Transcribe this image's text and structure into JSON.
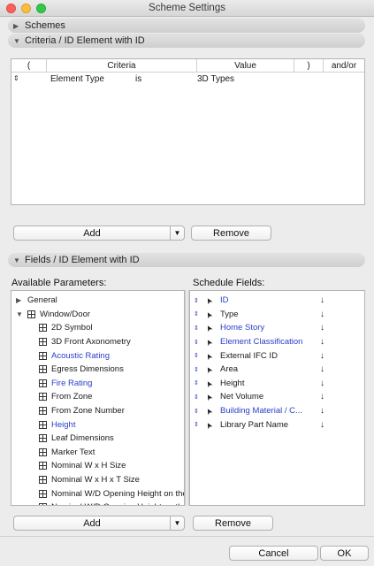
{
  "window": {
    "title": "Scheme Settings"
  },
  "schemes": {
    "label": "Schemes"
  },
  "criteria": {
    "label": "Criteria / ID Element with ID",
    "columns": [
      "(",
      "Criteria",
      "Value",
      ")",
      "and/or"
    ],
    "rows": [
      {
        "criteria": "Element Type",
        "op": "is",
        "value": "3D Types"
      }
    ],
    "add_label": "Add",
    "remove_label": "Remove"
  },
  "fields": {
    "label": "Fields / ID Element with ID",
    "available_label": "Available Parameters:",
    "schedule_label": "Schedule Fields:",
    "available": [
      {
        "text": "General",
        "level": 0,
        "expander": "collapsed",
        "icon": "none",
        "blue": false
      },
      {
        "text": "Window/Door",
        "level": 0,
        "expander": "expanded",
        "icon": "grid-icon",
        "blue": false
      },
      {
        "text": "2D Symbol",
        "level": 1,
        "icon": "grid-icon",
        "blue": false
      },
      {
        "text": "3D Front Axonometry",
        "level": 1,
        "icon": "grid-icon",
        "blue": false
      },
      {
        "text": "Acoustic Rating",
        "level": 1,
        "icon": "grid-icon",
        "blue": true
      },
      {
        "text": "Egress Dimensions",
        "level": 1,
        "icon": "grid-icon",
        "blue": false
      },
      {
        "text": "Fire Rating",
        "level": 1,
        "icon": "grid-icon",
        "blue": true
      },
      {
        "text": "From Zone",
        "level": 1,
        "icon": "grid-icon",
        "blue": false
      },
      {
        "text": "From Zone Number",
        "level": 1,
        "icon": "grid-icon",
        "blue": false
      },
      {
        "text": "Height",
        "level": 1,
        "icon": "grid-icon",
        "blue": true
      },
      {
        "text": "Leaf Dimensions",
        "level": 1,
        "icon": "grid-icon",
        "blue": false
      },
      {
        "text": "Marker Text",
        "level": 1,
        "icon": "grid-icon",
        "blue": false
      },
      {
        "text": "Nominal W x H Size",
        "level": 1,
        "icon": "grid-icon",
        "blue": false
      },
      {
        "text": "Nominal W x H x T Size",
        "level": 1,
        "icon": "grid-icon",
        "blue": false
      },
      {
        "text": "Nominal W/D Opening Height on the",
        "level": 1,
        "icon": "grid-icon",
        "blue": false
      },
      {
        "text": "Nominal W/D Opening Height on th",
        "level": 1,
        "icon": "grid-icon",
        "blue": false
      }
    ],
    "schedule": [
      {
        "text": "ID",
        "blue": true
      },
      {
        "text": "Type",
        "blue": false
      },
      {
        "text": "Home Story",
        "blue": true
      },
      {
        "text": "Element Classification",
        "blue": true
      },
      {
        "text": "External IFC ID",
        "blue": false
      },
      {
        "text": "Area",
        "blue": false
      },
      {
        "text": "Height",
        "blue": false
      },
      {
        "text": "Net Volume",
        "blue": false
      },
      {
        "text": "Building Material / C...",
        "blue": true
      },
      {
        "text": "Library Part Name",
        "blue": false
      }
    ],
    "add_label": "Add",
    "remove_label": "Remove"
  },
  "footer": {
    "cancel_label": "Cancel",
    "ok_label": "OK"
  }
}
